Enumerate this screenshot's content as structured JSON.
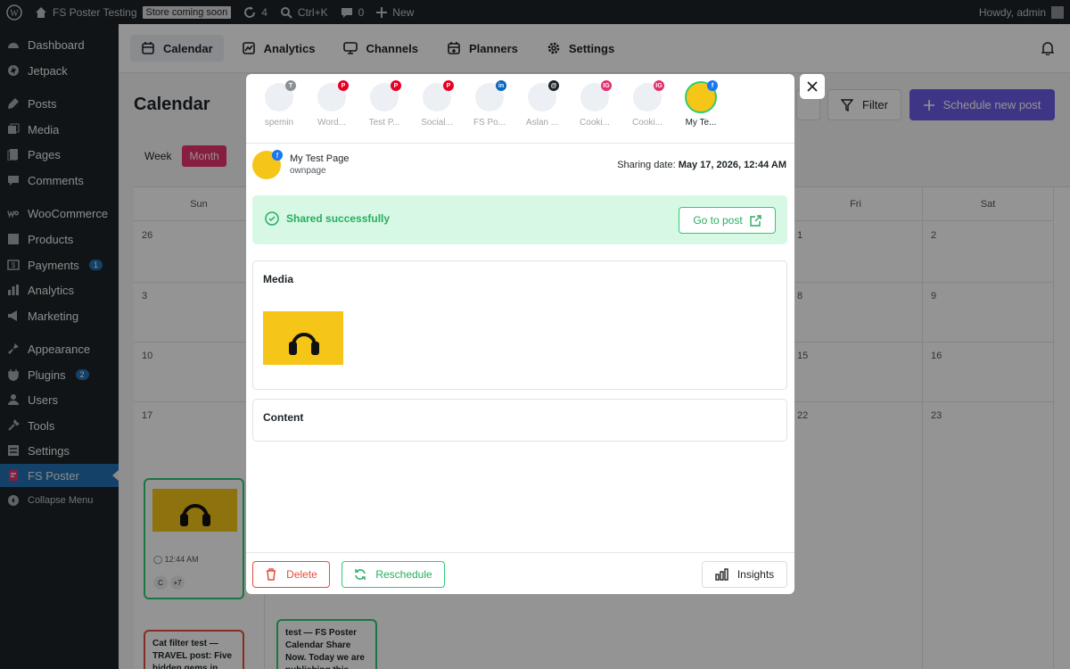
{
  "admin_bar": {
    "site_name": "FS Poster Testing",
    "store_badge": "Store coming soon",
    "updates_count": "4",
    "search_shortcut": "Ctrl+K",
    "comments_count": "0",
    "new_label": "New",
    "greeting": "Howdy, admin"
  },
  "sidebar": {
    "items": [
      {
        "label": "Dashboard",
        "icon": "dashboard-icon"
      },
      {
        "label": "Jetpack",
        "icon": "jetpack-icon"
      },
      {
        "label": "Posts",
        "icon": "posts-icon"
      },
      {
        "label": "Media",
        "icon": "media-icon"
      },
      {
        "label": "Pages",
        "icon": "pages-icon"
      },
      {
        "label": "Comments",
        "icon": "comments-icon"
      },
      {
        "label": "WooCommerce",
        "icon": "woocommerce-icon"
      },
      {
        "label": "Products",
        "icon": "products-icon"
      },
      {
        "label": "Payments",
        "icon": "payments-icon",
        "badge": "1"
      },
      {
        "label": "Analytics",
        "icon": "analytics-icon"
      },
      {
        "label": "Marketing",
        "icon": "marketing-icon"
      },
      {
        "label": "Appearance",
        "icon": "appearance-icon"
      },
      {
        "label": "Plugins",
        "icon": "plugins-icon",
        "badge": "2"
      },
      {
        "label": "Users",
        "icon": "users-icon"
      },
      {
        "label": "Tools",
        "icon": "tools-icon"
      },
      {
        "label": "Settings",
        "icon": "settings-icon"
      },
      {
        "label": "FS Poster",
        "icon": "fs-poster-icon"
      },
      {
        "label": "Collapse Menu",
        "icon": "collapse-icon"
      }
    ]
  },
  "topnav": {
    "tabs": [
      {
        "label": "Calendar"
      },
      {
        "label": "Analytics"
      },
      {
        "label": "Channels"
      },
      {
        "label": "Planners"
      },
      {
        "label": "Settings"
      }
    ]
  },
  "page": {
    "title": "Calendar",
    "filter_label": "Filter",
    "schedule_label": "Schedule new post",
    "view_week": "Week",
    "view_month": "Month"
  },
  "calendar": {
    "days": [
      "Sun",
      "Fri",
      "Sat"
    ],
    "dates": {
      "sun": [
        "26",
        "3",
        "10",
        "17"
      ],
      "fri": [
        "1",
        "8",
        "15",
        "22"
      ],
      "sat": [
        "2",
        "9",
        "16",
        "23"
      ]
    },
    "event1": {
      "time": "12:44 AM",
      "extra": "+7"
    },
    "event2": {
      "text": "Cat filter test — TRAVEL post: Five hidden gems in"
    },
    "event3": {
      "text": "test — FS Poster Calendar Share Now. Today we are publishing this..."
    }
  },
  "modal": {
    "channels": [
      {
        "name": "spemin",
        "badge": "T",
        "badge_color": "#8c8f94"
      },
      {
        "name": "Word...",
        "badge": "P",
        "badge_color": "#e60023"
      },
      {
        "name": "Test P...",
        "badge": "P",
        "badge_color": "#e60023"
      },
      {
        "name": "Social...",
        "badge": "P",
        "badge_color": "#e60023"
      },
      {
        "name": "FS Po...",
        "badge": "in",
        "badge_color": "#0a66c2"
      },
      {
        "name": "Aslan ...",
        "badge": "@",
        "badge_color": "#1d2327"
      },
      {
        "name": "Cooki...",
        "badge": "IG",
        "badge_color": "#e1306c"
      },
      {
        "name": "Cooki...",
        "badge": "IG",
        "badge_color": "#e1306c"
      },
      {
        "name": "My Te...",
        "badge": "f",
        "badge_color": "#1877f2"
      }
    ],
    "account": {
      "name": "My Test Page",
      "type": "ownpage",
      "sharing_label": "Sharing date:",
      "sharing_date": "May 17, 2026, 12:44 AM"
    },
    "status": {
      "text": "Shared successfully",
      "goto_label": "Go to post"
    },
    "media_title": "Media",
    "content_title": "Content",
    "footer": {
      "delete_label": "Delete",
      "reschedule_label": "Reschedule",
      "insights_label": "Insights"
    }
  },
  "colors": {
    "accent": "#6c5ce7",
    "success": "#27ae60",
    "danger": "#e74c3c",
    "month_toggle": "#e8336d"
  }
}
